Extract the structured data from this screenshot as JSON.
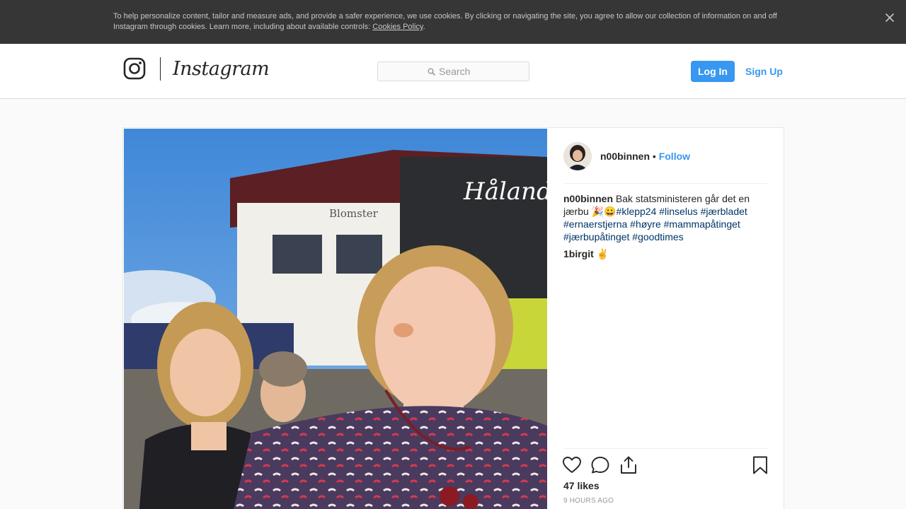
{
  "cookie_banner": {
    "text": "To help personalize content, tailor and measure ads, and provide a safer experience, we use cookies. By clicking or navigating the site, you agree to allow our collection of information on and off Instagram through cookies. Learn more, including about available controls: ",
    "link_label": "Cookies Policy",
    "link_suffix": ".",
    "close_icon": "close-icon"
  },
  "header": {
    "brand": "Instagram",
    "logo_icon": "instagram-camera-icon",
    "search": {
      "placeholder": "Search",
      "value": "",
      "icon": "search-icon"
    },
    "login_label": "Log In",
    "signup_label": "Sign Up"
  },
  "post": {
    "author": "n00binnen",
    "follow_separator": "•",
    "follow_label": "Follow",
    "caption": {
      "author": "n00binnen",
      "text": "Bak statsministeren går det en jærbu 🎉😀",
      "hashtags": [
        "#klepp24",
        "#linselus",
        "#jærbladet",
        "#ernaerstjerna",
        "#høyre",
        "#mammapåtinget",
        "#jærbupåtinget",
        "#goodtimes"
      ]
    },
    "comments": [
      {
        "user": "1birgit",
        "text": "✌"
      }
    ],
    "actions": [
      "heart-icon",
      "comment-icon",
      "share-icon",
      "bookmark-icon"
    ],
    "likes_text": "47 likes",
    "timestamp": "9 HOURS AGO"
  },
  "colors": {
    "accent": "#3897f0",
    "cookie_bar": "#363636",
    "hashtag": "#003569",
    "border": "#dbdbdb"
  }
}
